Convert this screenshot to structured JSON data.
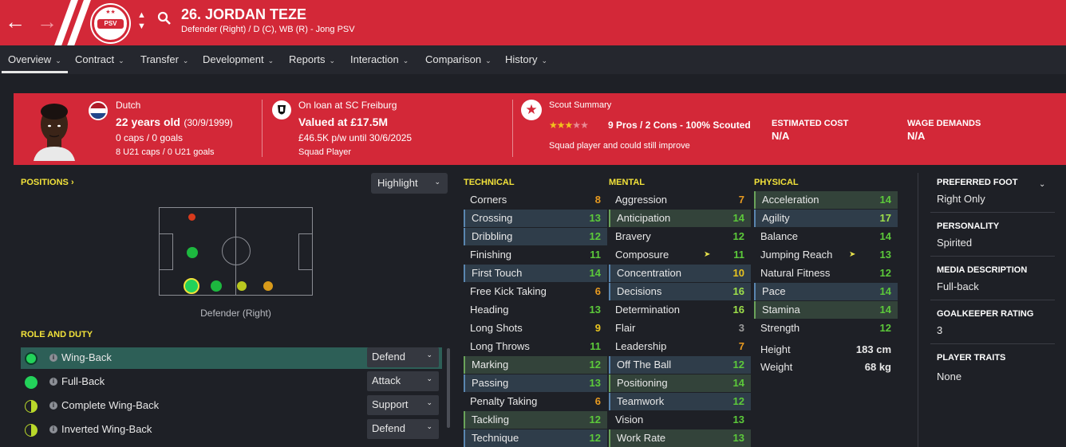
{
  "header": {
    "player_number_name": "26. JORDAN TEZE",
    "subtitle": "Defender (Right) / D (C), WB (R) - Jong PSV",
    "club_badge_text": "PSV",
    "colors": {
      "brand": "#d32838",
      "highlight_label": "#f2e23a"
    }
  },
  "menu": [
    {
      "label": "Overview",
      "active": true
    },
    {
      "label": "Contract"
    },
    {
      "label": "Transfer"
    },
    {
      "label": "Development"
    },
    {
      "label": "Reports"
    },
    {
      "label": "Interaction"
    },
    {
      "label": "Comparison"
    },
    {
      "label": "History"
    }
  ],
  "card": {
    "nationality": "Dutch",
    "age": "22 years old",
    "dob": "(30/9/1999)",
    "caps_goals": "0 caps / 0 goals",
    "u21": "8 U21 caps / 0 U21 goals",
    "loan": "On loan at SC Freiburg",
    "value": "Valued at £17.5M",
    "wage": "£46.5K p/w until 30/6/2025",
    "squad_status": "Squad Player",
    "scout_title": "Scout Summary",
    "scout_stars": 2.5,
    "scout_summary": "9 Pros / 2 Cons - 100% Scouted",
    "scout_note": "Squad player and could still improve",
    "estimated_cost_label": "ESTIMATED COST",
    "estimated_cost_value": "N/A",
    "wage_demands_label": "WAGE DEMANDS",
    "wage_demands_value": "N/A"
  },
  "positions": {
    "title": "POSITIONS",
    "highlight_label": "Highlight",
    "caption": "Defender (Right)"
  },
  "role_duty": {
    "title": "ROLE AND DUTY",
    "roles": [
      {
        "name": "Wing-Back",
        "duty": "Defend",
        "selected": true
      },
      {
        "name": "Full-Back",
        "duty": "Attack"
      },
      {
        "name": "Complete Wing-Back",
        "duty": "Support"
      },
      {
        "name": "Inverted Wing-Back",
        "duty": "Defend"
      }
    ]
  },
  "technical": {
    "title": "TECHNICAL",
    "attrs": [
      {
        "name": "Corners",
        "value": "8"
      },
      {
        "name": "Crossing",
        "value": "13"
      },
      {
        "name": "Dribbling",
        "value": "12"
      },
      {
        "name": "Finishing",
        "value": "11"
      },
      {
        "name": "First Touch",
        "value": "14"
      },
      {
        "name": "Free Kick Taking",
        "value": "6"
      },
      {
        "name": "Heading",
        "value": "13"
      },
      {
        "name": "Long Shots",
        "value": "9"
      },
      {
        "name": "Long Throws",
        "value": "11"
      },
      {
        "name": "Marking",
        "value": "12"
      },
      {
        "name": "Passing",
        "value": "13"
      },
      {
        "name": "Penalty Taking",
        "value": "6"
      },
      {
        "name": "Tackling",
        "value": "12"
      },
      {
        "name": "Technique",
        "value": "12"
      }
    ]
  },
  "mental": {
    "title": "MENTAL",
    "attrs": [
      {
        "name": "Aggression",
        "value": "7"
      },
      {
        "name": "Anticipation",
        "value": "14"
      },
      {
        "name": "Bravery",
        "value": "12"
      },
      {
        "name": "Composure",
        "value": "11"
      },
      {
        "name": "Concentration",
        "value": "10"
      },
      {
        "name": "Decisions",
        "value": "16"
      },
      {
        "name": "Determination",
        "value": "16"
      },
      {
        "name": "Flair",
        "value": "3"
      },
      {
        "name": "Leadership",
        "value": "7"
      },
      {
        "name": "Off The Ball",
        "value": "12"
      },
      {
        "name": "Positioning",
        "value": "14"
      },
      {
        "name": "Teamwork",
        "value": "12"
      },
      {
        "name": "Vision",
        "value": "13"
      },
      {
        "name": "Work Rate",
        "value": "13"
      }
    ]
  },
  "physical": {
    "title": "PHYSICAL",
    "attrs": [
      {
        "name": "Acceleration",
        "value": "14"
      },
      {
        "name": "Agility",
        "value": "17"
      },
      {
        "name": "Balance",
        "value": "14"
      },
      {
        "name": "Jumping Reach",
        "value": "13"
      },
      {
        "name": "Natural Fitness",
        "value": "12"
      },
      {
        "name": "Pace",
        "value": "14"
      },
      {
        "name": "Stamina",
        "value": "14"
      },
      {
        "name": "Strength",
        "value": "12"
      }
    ],
    "height_label": "Height",
    "height_value": "183 cm",
    "weight_label": "Weight",
    "weight_value": "68 kg"
  },
  "sidebar": {
    "preferred_foot_label": "PREFERRED FOOT",
    "preferred_foot_value": "Right Only",
    "personality_label": "PERSONALITY",
    "personality_value": "Spirited",
    "media_label": "MEDIA DESCRIPTION",
    "media_value": "Full-back",
    "gk_label": "GOALKEEPER RATING",
    "gk_value": "3",
    "traits_label": "PLAYER TRAITS",
    "traits_value": "None"
  }
}
